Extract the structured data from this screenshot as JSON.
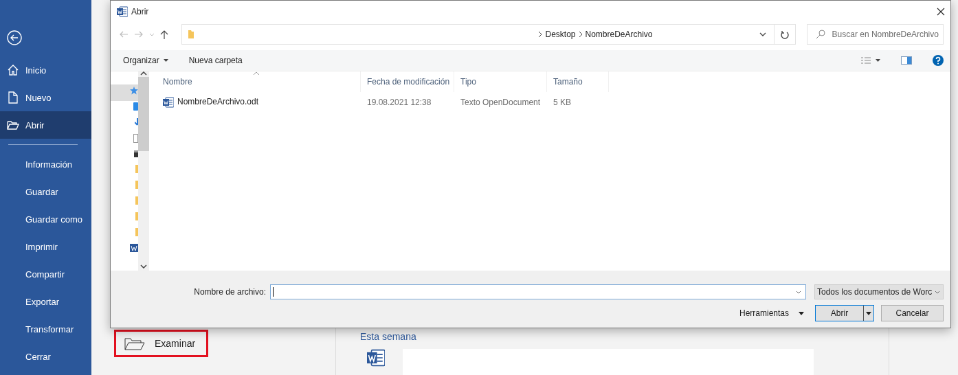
{
  "sidebar": {
    "items": [
      {
        "label": "Inicio",
        "kind": "primary",
        "selected": false
      },
      {
        "label": "Nuevo",
        "kind": "primary",
        "selected": false
      },
      {
        "label": "Abrir",
        "kind": "primary",
        "selected": true
      },
      {
        "label": "Información",
        "kind": "secondary",
        "selected": false
      },
      {
        "label": "Guardar",
        "kind": "secondary",
        "selected": false
      },
      {
        "label": "Guardar como",
        "kind": "secondary",
        "selected": false
      },
      {
        "label": "Imprimir",
        "kind": "secondary",
        "selected": false
      },
      {
        "label": "Compartir",
        "kind": "secondary",
        "selected": false
      },
      {
        "label": "Exportar",
        "kind": "secondary",
        "selected": false
      },
      {
        "label": "Transformar",
        "kind": "secondary",
        "selected": false
      },
      {
        "label": "Cerrar",
        "kind": "secondary",
        "selected": false
      }
    ]
  },
  "backstage": {
    "browse_button": "Examinar",
    "section_heading": "Esta semana"
  },
  "dialog": {
    "title": "Abrir",
    "breadcrumb": [
      "Desktop",
      "NombreDeArchivo"
    ],
    "search": {
      "placeholder": "Buscar en NombreDeArchivo"
    },
    "toolbar": {
      "organize": "Organizar",
      "new_folder": "Nueva carpeta"
    },
    "columns": [
      "Nombre",
      "Fecha de modificación",
      "Tipo",
      "Tamaño"
    ],
    "rows": [
      {
        "cells": [
          "NombreDeArchivo.odt",
          "19.08.2021 12:38",
          "Texto OpenDocument",
          "5 KB"
        ]
      }
    ],
    "filename": {
      "label": "Nombre de archivo:"
    },
    "filetype": "Todos los documentos de Worc",
    "tools": "Herramientas",
    "buttons": [
      "Abrir",
      "Cancelar"
    ]
  }
}
